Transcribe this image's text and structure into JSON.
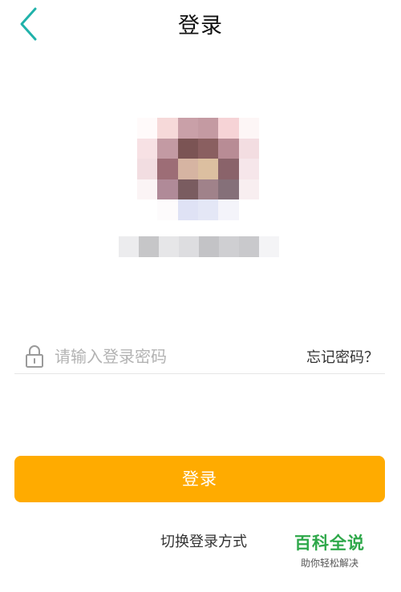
{
  "nav": {
    "title": "登录",
    "back_icon": "chevron-left-icon",
    "accent": "#20b2aa"
  },
  "profile": {
    "avatar_blurred": true,
    "username_blurred": true
  },
  "password": {
    "placeholder": "请输入登录密码",
    "value": "",
    "lock_icon": "lock-icon",
    "forgot_label": "忘记密码？"
  },
  "login_button": {
    "label": "登录",
    "color": "#ffab00"
  },
  "switch_label": "切换登录方式",
  "watermark": {
    "title": "百科全说",
    "subtitle": "助你轻松解决"
  }
}
